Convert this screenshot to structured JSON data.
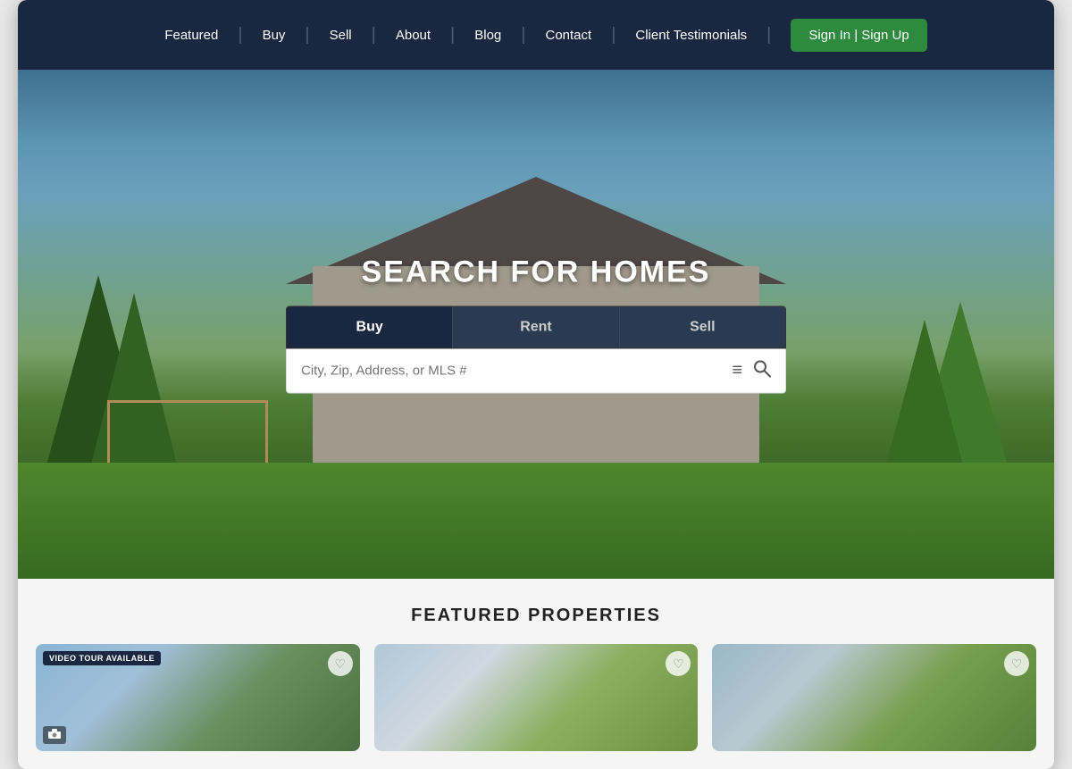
{
  "nav": {
    "links": [
      {
        "label": "Featured",
        "id": "featured"
      },
      {
        "label": "Buy",
        "id": "buy"
      },
      {
        "label": "Sell",
        "id": "sell"
      },
      {
        "label": "About",
        "id": "about"
      },
      {
        "label": "Blog",
        "id": "blog"
      },
      {
        "label": "Contact",
        "id": "contact"
      },
      {
        "label": "Client Testimonials",
        "id": "testimonials"
      }
    ],
    "auth_button": "Sign In | Sign Up"
  },
  "hero": {
    "title": "SEARCH FOR HOMES",
    "tabs": [
      {
        "label": "Buy",
        "active": true
      },
      {
        "label": "Rent",
        "active": false
      },
      {
        "label": "Sell",
        "active": false
      }
    ],
    "search_placeholder": "City, Zip, Address, or MLS #"
  },
  "featured": {
    "section_title": "FEATURED PROPERTIES",
    "cards": [
      {
        "badge": "VIDEO TOUR AVAILABLE",
        "has_heart": true,
        "has_camera": true
      },
      {
        "badge": "",
        "has_heart": true,
        "has_camera": false
      },
      {
        "badge": "",
        "has_heart": true,
        "has_camera": false
      }
    ]
  },
  "icons": {
    "filter": "≡",
    "search": "🔍",
    "heart": "♡",
    "camera": "📷"
  }
}
